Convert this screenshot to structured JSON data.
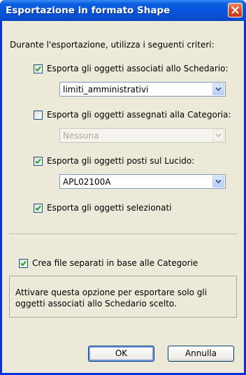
{
  "window": {
    "title": "Esportazione in formato Shape"
  },
  "intro_label": "Durante l'esportazione, utilizza i seguenti criteri:",
  "options": {
    "schedario": {
      "label": "Esporta gli oggetti associati allo Schedario:",
      "checked": true,
      "select_value": "limiti_amministrativi"
    },
    "categoria": {
      "label": "Esporta gli oggetti assegnati alla Categoria:",
      "checked": false,
      "select_value": "Nessuna",
      "disabled": true
    },
    "lucido": {
      "label": "Esporta gli oggetti posti sul Lucido:",
      "checked": true,
      "select_value": "APL02100A"
    },
    "selezionati": {
      "label": "Esporta gli oggetti selezionati",
      "checked": true
    },
    "file_separati": {
      "label": "Crea file separati in base alle Categorie",
      "checked": true
    }
  },
  "help_text": "Attivare questa opzione per esportare solo gli oggetti associati allo Schedario scelto.",
  "buttons": {
    "ok": "OK",
    "cancel": "Annulla"
  },
  "colors": {
    "titlebar": "#0855dd",
    "client_bg": "#ece9d8",
    "check_mark": "#21a121",
    "close_button": "#d9461e"
  }
}
